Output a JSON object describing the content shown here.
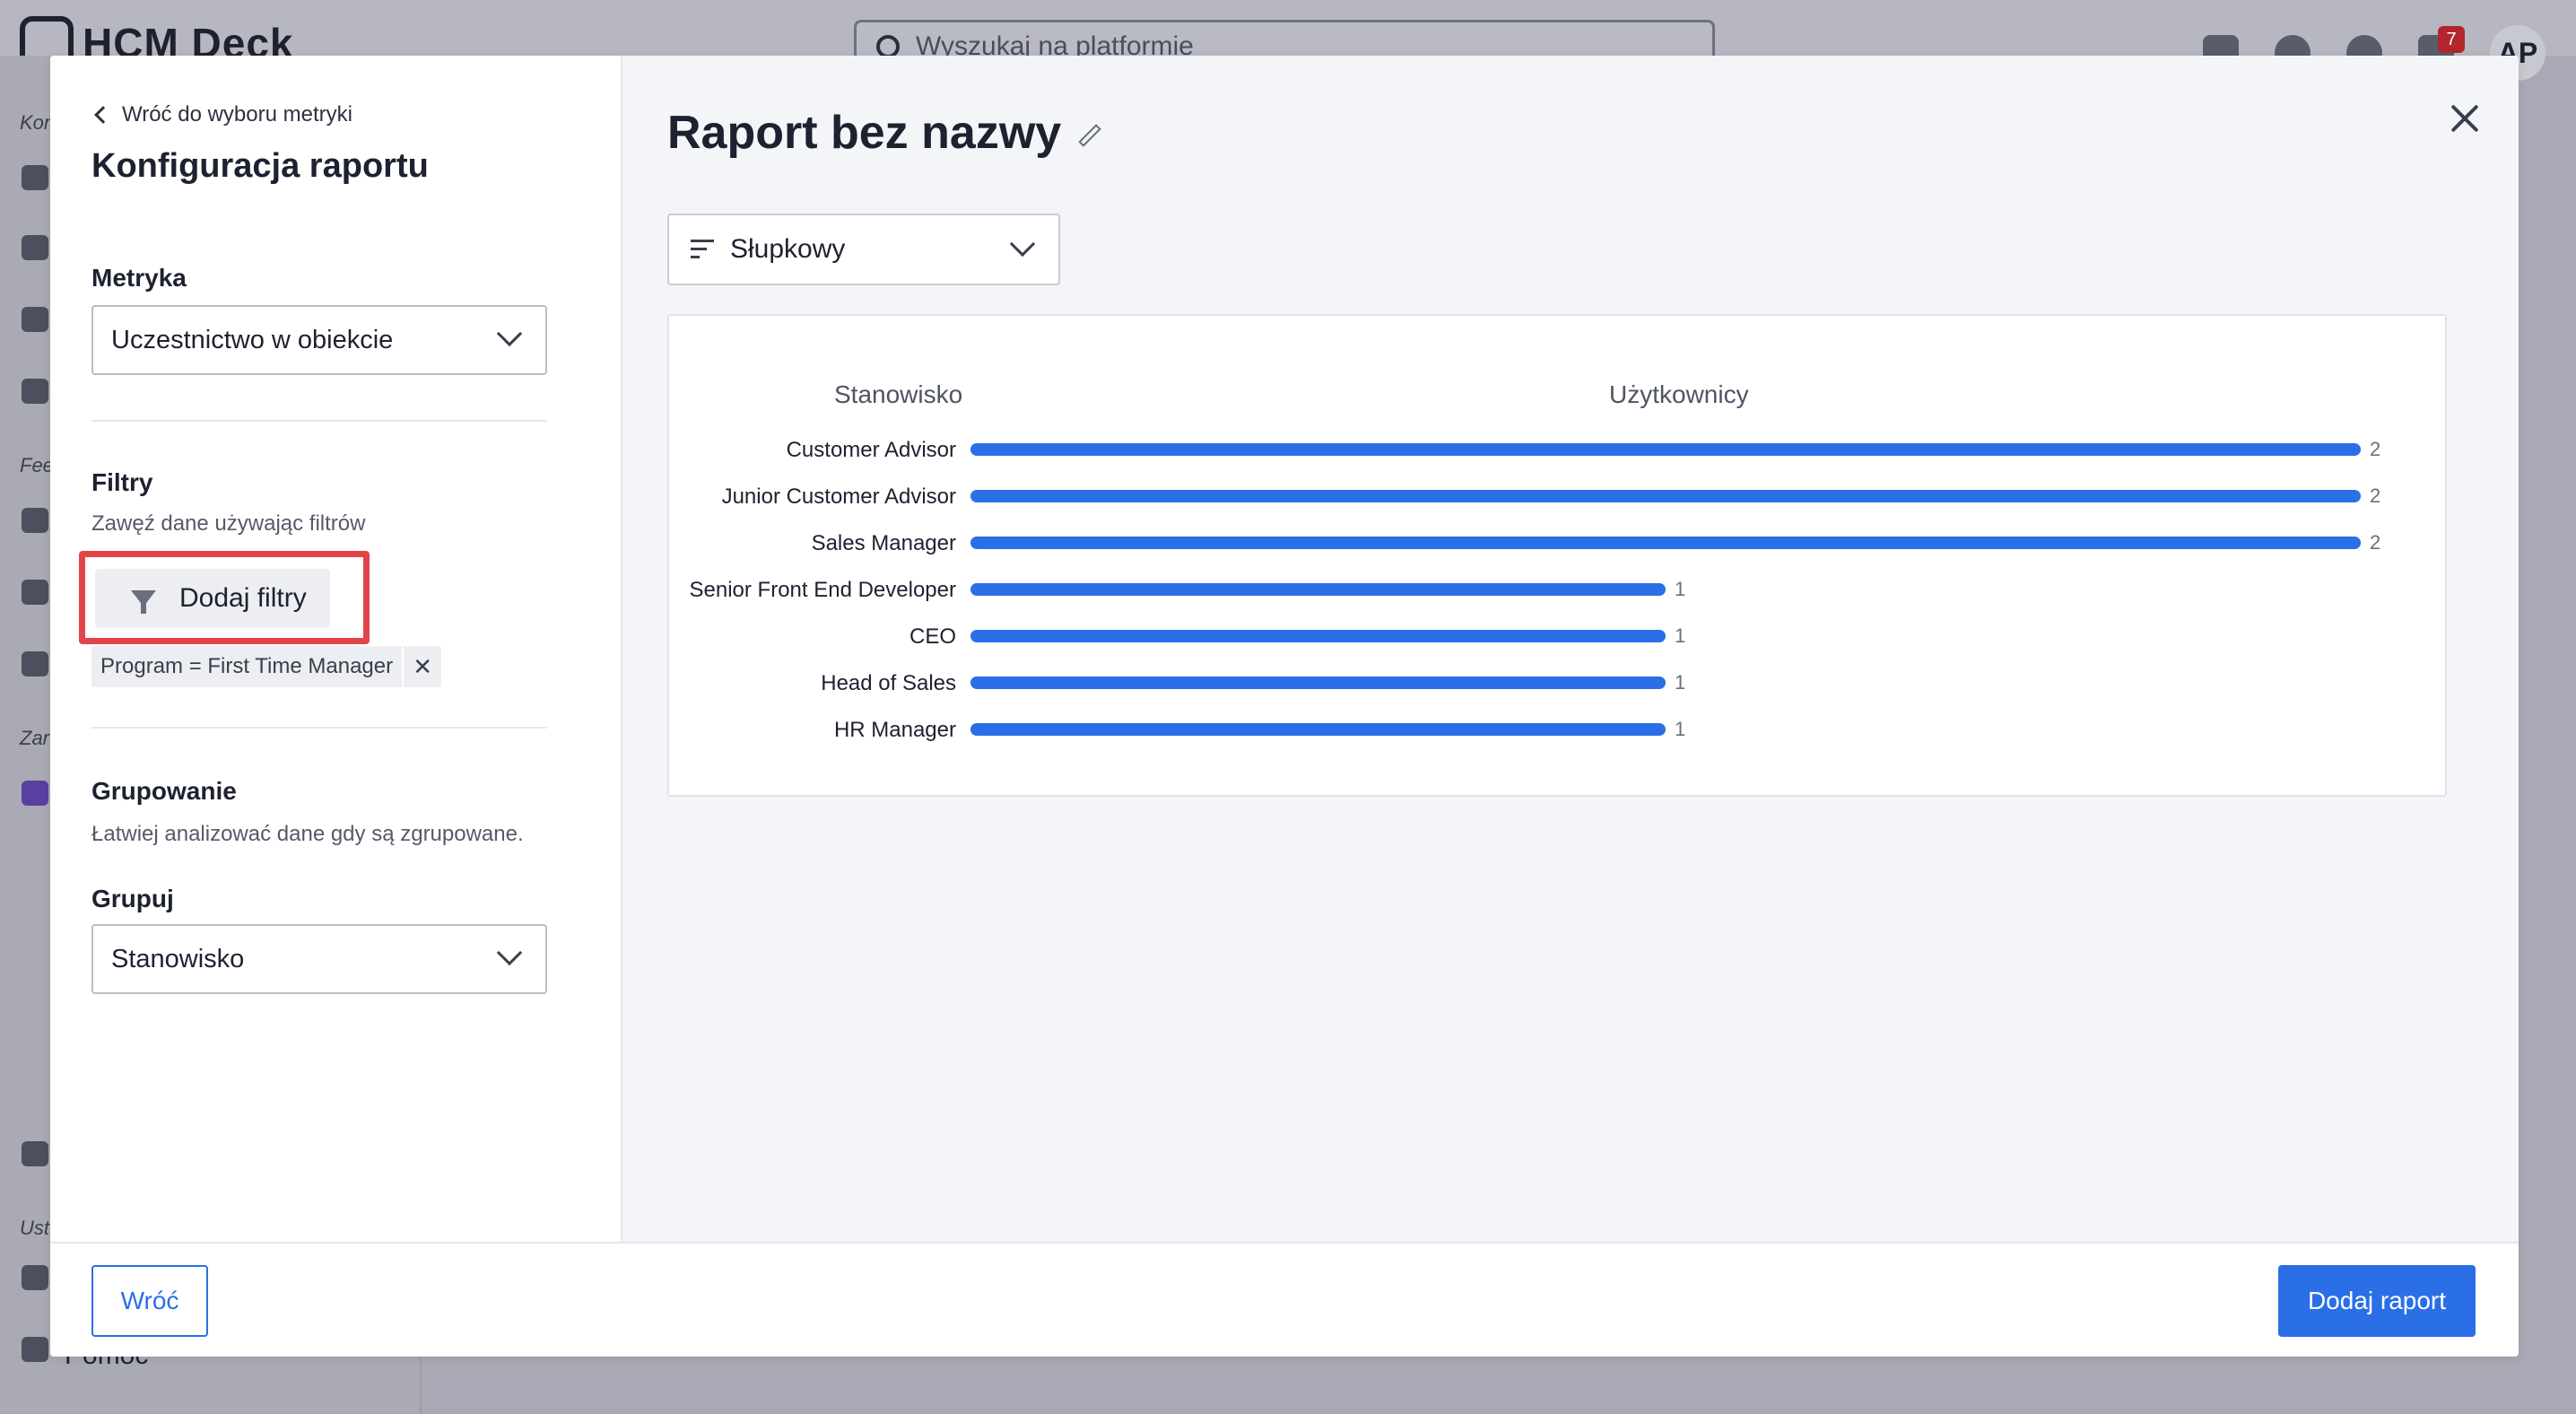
{
  "background": {
    "app_name": "HCM Deck",
    "search_placeholder": "Wyszukaj na platformie",
    "notification_count": "7",
    "avatar_initials": "AP",
    "sidebar_section_1": "Kon",
    "sidebar_section_2": "Fee",
    "sidebar_section_3": "Zar",
    "sidebar_section_4": "Ust",
    "help_label": "Pomoc"
  },
  "left_panel": {
    "back_link": "Wróć do wyboru metryki",
    "title": "Konfiguracja raportu",
    "metric": {
      "label": "Metryka",
      "value": "Uczestnictwo w obiekcie"
    },
    "filters": {
      "label": "Filtry",
      "description": "Zawęź dane używając filtrów",
      "add_button": "Dodaj filtry",
      "active_filter": "Program = First Time Manager",
      "remove_symbol": "✕"
    },
    "grouping": {
      "label": "Grupowanie",
      "description": "Łatwiej analizować dane gdy są zgrupowane.",
      "group_label": "Grupuj",
      "group_value": "Stanowisko"
    }
  },
  "right_panel": {
    "report_title": "Raport bez nazwy",
    "chart_type": "Słupkowy"
  },
  "chart_data": {
    "type": "bar",
    "orientation": "horizontal",
    "category_header": "Stanowisko",
    "value_header": "Użytkownicy",
    "categories": [
      "Customer Advisor",
      "Junior Customer Advisor",
      "Sales Manager",
      "Senior Front End Developer",
      "CEO",
      "Head of Sales",
      "HR Manager"
    ],
    "values": [
      2,
      2,
      2,
      1,
      1,
      1,
      1
    ],
    "xlim": [
      0,
      2
    ],
    "color": "#2a6fe6"
  },
  "footer": {
    "back_button": "Wróć",
    "add_button": "Dodaj raport"
  },
  "colors": {
    "primary": "#2a6fe6",
    "highlight": "#e34449"
  }
}
